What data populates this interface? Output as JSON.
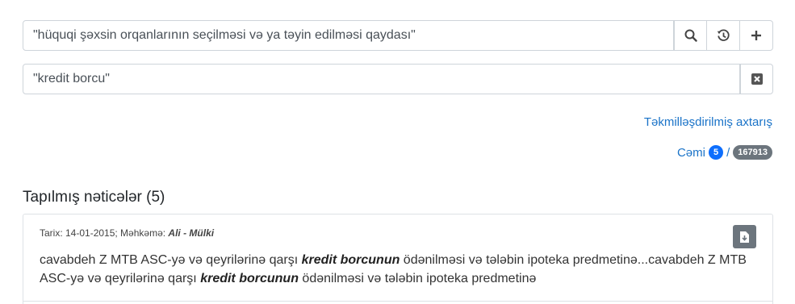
{
  "search": {
    "query1": "\"hüquqi şəxsin orqanlarının seçilməsi və ya təyin edilməsi qaydası\"",
    "query2": "\"kredit borcu\""
  },
  "icons": {
    "search": "search-icon",
    "history": "history-icon",
    "add": "plus-icon",
    "clear": "clear-x-icon",
    "download": "download-file-icon"
  },
  "advanced_search_label": "Təkmilləşdirilmiş axtarış",
  "total": {
    "label": "Cəmi",
    "found": "5",
    "separator": "/",
    "all": "167913"
  },
  "results_title": "Tapılmış nəticələr (5)",
  "results": [
    {
      "meta_prefix": "Tarix: 14-01-2015; Məhkəmə:",
      "court": "Ali - Mülki",
      "excerpt_parts": [
        "cavabdeh Z MTB ASC-yə və qeyrilərinə qarşı ",
        "kredit borcunun",
        " ödənilməsi və tələbin ipoteka predmetinə...cavabdeh Z MTB ASC-yə və qeyrilərinə qarşı ",
        "kredit borcunun",
        " ödənilməsi və tələbin ipoteka predmetinə"
      ]
    }
  ],
  "colors": {
    "link": "#1a73c8",
    "badge_blue": "#0d6efd",
    "badge_gray": "#6c757d"
  }
}
